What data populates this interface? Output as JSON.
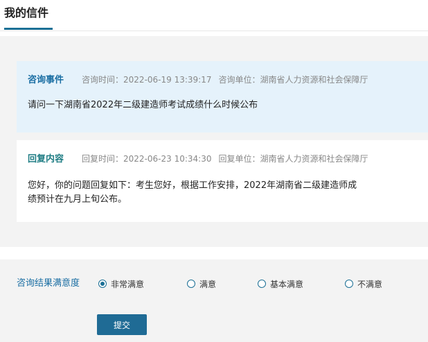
{
  "header": {
    "title": "我的信件"
  },
  "inquiry": {
    "heading": "咨询事件",
    "time_label": "咨询时间：",
    "time_value": "2022-06-19 13:39:17",
    "unit_label": "咨询单位：",
    "unit_value": "湖南省人力资源和社会保障厅",
    "content": "请问一下湖南省2022年二级建造师考试成绩什么时候公布"
  },
  "reply": {
    "heading": "回复内容",
    "time_label": "回复时间：",
    "time_value": "2022-06-23 10:34:30",
    "unit_label": "回复单位：",
    "unit_value": "湖南省人力资源和社会保障厅",
    "content": "您好，你的问题回复如下：考生您好，根据工作安排，2022年湖南省二级建造师成绩预计在九月上旬公布。"
  },
  "satisfaction": {
    "label": "咨询结果满意度",
    "options": [
      {
        "label": "非常满意",
        "checked": true
      },
      {
        "label": "满意",
        "checked": false
      },
      {
        "label": "基本满意",
        "checked": false
      },
      {
        "label": "不满意",
        "checked": false
      }
    ],
    "submit_label": "提交"
  },
  "colors": {
    "accent": "#1b6f95",
    "inquiry_bg": "#e5f2fb",
    "page_bg": "#f3f3f3"
  }
}
